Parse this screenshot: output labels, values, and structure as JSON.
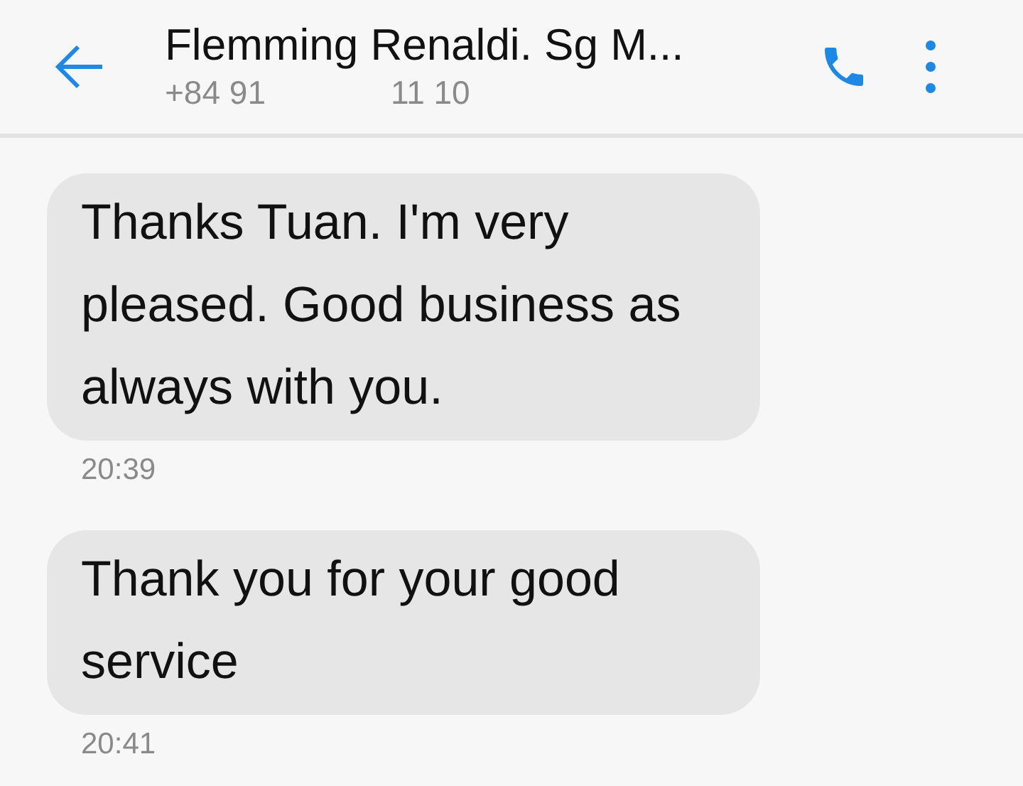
{
  "header": {
    "title": "Flemming Renaldi. Sg M...",
    "phone_start": "+84 91",
    "phone_end": "11 10"
  },
  "messages": [
    {
      "text": "Thanks Tuan. I'm very pleased. Good business as always with you.",
      "time": "20:39"
    },
    {
      "text": "Thank you for your good service",
      "time": "20:41"
    }
  ]
}
